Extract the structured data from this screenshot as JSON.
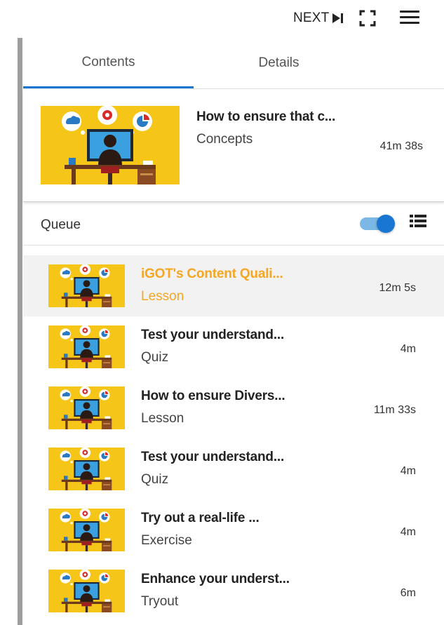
{
  "topbar": {
    "next_label": "NEXT"
  },
  "tabs": [
    {
      "label": "Contents",
      "active": true
    },
    {
      "label": "Details",
      "active": false
    }
  ],
  "current": {
    "title": "How to ensure that c...",
    "type": "Concepts",
    "duration": "41m 38s"
  },
  "queue": {
    "label": "Queue",
    "autoplay_on": true,
    "items": [
      {
        "title": "iGOT's Content Quali...",
        "type": "Lesson",
        "duration": "12m 5s",
        "current": true
      },
      {
        "title": "Test your understand...",
        "type": "Quiz",
        "duration": "4m",
        "current": false
      },
      {
        "title": "How to ensure Divers...",
        "type": "Lesson",
        "duration": "11m 33s",
        "current": false
      },
      {
        "title": "Test your understand...",
        "type": "Quiz",
        "duration": "4m",
        "current": false
      },
      {
        "title": "Try out a real-life ...",
        "type": "Exercise",
        "duration": "4m",
        "current": false
      },
      {
        "title": "Enhance your underst...",
        "type": "Tryout",
        "duration": "6m",
        "current": false
      }
    ]
  },
  "colors": {
    "accent": "#1976d2",
    "current_item_text": "#f5a623",
    "thumbnail_bg": "#f5c518"
  },
  "icons": {
    "next": "skip-next-icon",
    "fullscreen": "fullscreen-icon",
    "menu": "hamburger-menu-icon",
    "list_view": "list-view-icon"
  }
}
